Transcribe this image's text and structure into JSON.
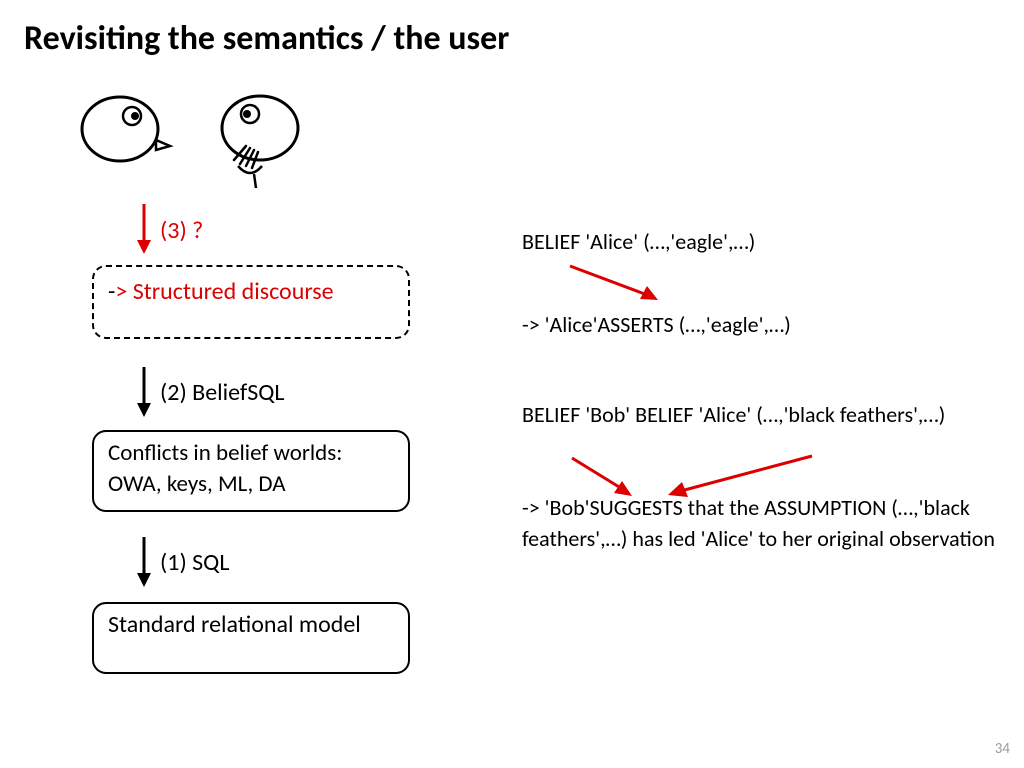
{
  "title": "Revisiting the semantics / the user",
  "step3": {
    "label": "(3) ?",
    "box_dash": "-",
    "box_rest": "> Structured discourse"
  },
  "step2": {
    "label": "(2) BeliefSQL",
    "box": "Conflicts in belief worlds: OWA, keys, ML, DA"
  },
  "step1": {
    "label": "(1) SQL",
    "box": "Standard relational model"
  },
  "right1": {
    "line1": "BELIEF 'Alice' (…,'eagle',…)",
    "line2": "-> 'Alice'ASSERTS (…,'eagle',…)"
  },
  "right2": {
    "line1": "BELIEF 'Bob' BELIEF  'Alice' (…,'black feathers',…)",
    "line2": "-> 'Bob'SUGGESTS that the ASSUMPTION (…,'black feathers',…) has led 'Alice' to her original observation"
  },
  "page_number": "34"
}
